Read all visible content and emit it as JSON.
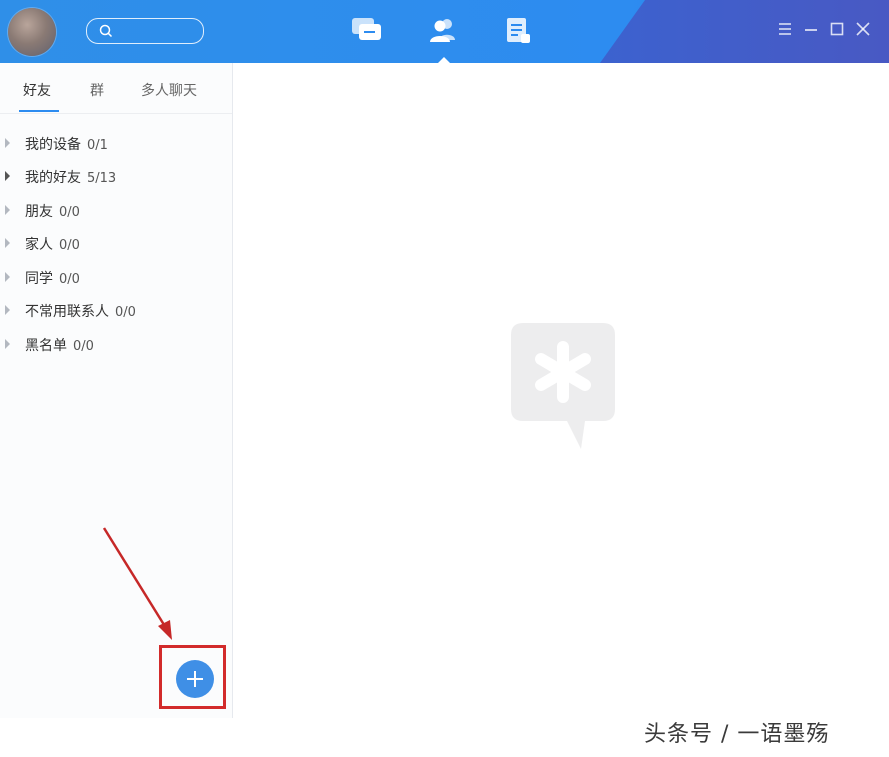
{
  "tabs": [
    {
      "label": "好友"
    },
    {
      "label": "群"
    },
    {
      "label": "多人聊天"
    }
  ],
  "groups": [
    {
      "name": "我的设备",
      "count": "0/1"
    },
    {
      "name": "我的好友",
      "count": "5/13"
    },
    {
      "name": "朋友",
      "count": "0/0"
    },
    {
      "name": "家人",
      "count": "0/0"
    },
    {
      "name": "同学",
      "count": "0/0"
    },
    {
      "name": "不常用联系人",
      "count": "0/0"
    },
    {
      "name": "黑名单",
      "count": "0/0"
    }
  ],
  "icons": {
    "nav": [
      "chat-bubble-icon",
      "contacts-icon",
      "document-icon"
    ],
    "window": [
      "menu-icon",
      "minimize-icon",
      "maximize-icon",
      "close-icon"
    ],
    "center_logo": "asterisk-speech-bubble-icon",
    "add": "plus-icon"
  },
  "colors": {
    "titlebar": "#2d8cf0",
    "accent": "#2d8cf0",
    "annotation": "#d22b2b"
  },
  "watermark": "头条号 / 一语墨殇"
}
